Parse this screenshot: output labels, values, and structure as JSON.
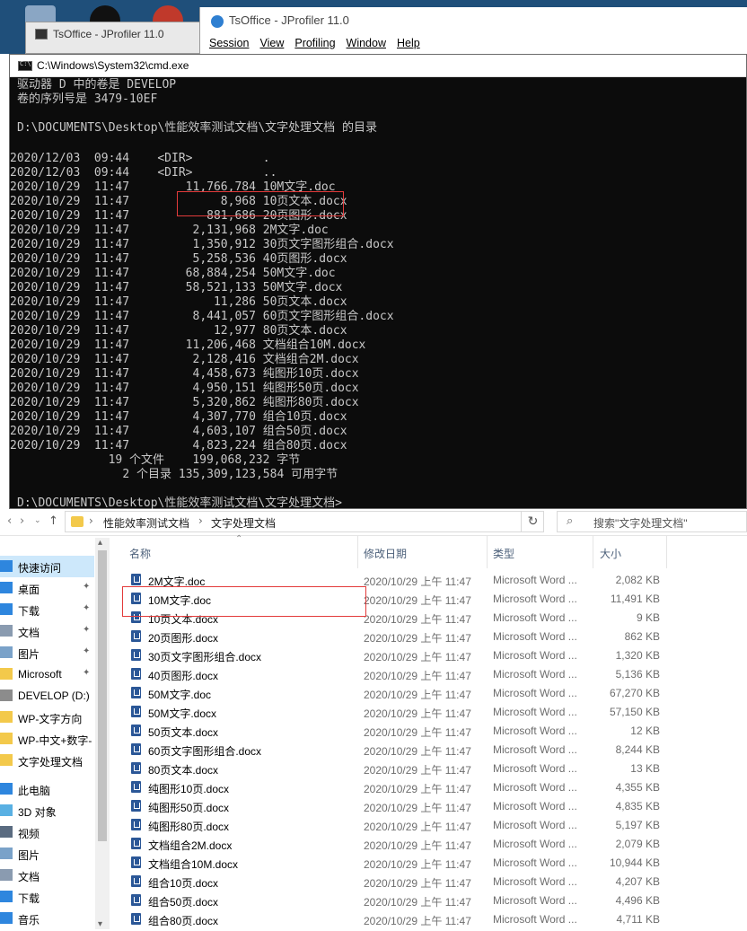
{
  "colors": {
    "cmd_bg": "#0c0c0c",
    "cmd_text": "#c8c8c8",
    "highlight_box": "#e33b3b",
    "nav_selected": "#cde8fb",
    "word_icon": "#2b5797",
    "folder": "#f3c94b"
  },
  "jprofiler_back": {
    "title": "TsOffice - JProfiler 11.0"
  },
  "jprofiler_front": {
    "title": "TsOffice - JProfiler 11.0",
    "menu": [
      "Session",
      "View",
      "Profiling",
      "Window",
      "Help"
    ]
  },
  "cmd": {
    "title": "C:\\Windows\\System32\\cmd.exe",
    "lines": [
      "驱动器 D 中的卷是 DEVELOP",
      "卷的序列号是 3479-10EF",
      "",
      "D:\\DOCUMENTS\\Desktop\\性能效率测试文档\\文字处理文档 的目录",
      "",
      "2020/12/03  09:44    <DIR>          .",
      "2020/12/03  09:44    <DIR>          ..",
      "2020/10/29  11:47        11,766,784 10M文字.doc",
      "2020/10/29  11:47             8,968 10页文本.docx",
      "2020/10/29  11:47           881,686 20页图形.docx",
      "2020/10/29  11:47         2,131,968 2M文字.doc",
      "2020/10/29  11:47         1,350,912 30页文字图形组合.docx",
      "2020/10/29  11:47         5,258,536 40页图形.docx",
      "2020/10/29  11:47        68,884,254 50M文字.doc",
      "2020/10/29  11:47        58,521,133 50M文字.docx",
      "2020/10/29  11:47            11,286 50页文本.docx",
      "2020/10/29  11:47         8,441,057 60页文字图形组合.docx",
      "2020/10/29  11:47            12,977 80页文本.docx",
      "2020/10/29  11:47        11,206,468 文档组合10M.docx",
      "2020/10/29  11:47         2,128,416 文档组合2M.docx",
      "2020/10/29  11:47         4,458,673 纯图形10页.docx",
      "2020/10/29  11:47         4,950,151 纯图形50页.docx",
      "2020/10/29  11:47         5,320,862 纯图形80页.docx",
      "2020/10/29  11:47         4,307,770 组合10页.docx",
      "2020/10/29  11:47         4,603,107 组合50页.docx",
      "2020/10/29  11:47         4,823,224 组合80页.docx",
      "              19 个文件    199,068,232 字节",
      "               2 个目录 135,309,123,584 可用字节",
      "",
      "D:\\DOCUMENTS\\Desktop\\性能效率测试文档\\文字处理文档>"
    ]
  },
  "explorer": {
    "address": {
      "crumbs": [
        "性能效率测试文档",
        "文字处理文档"
      ],
      "search_placeholder": "搜索\"文字处理文档\""
    },
    "nav": [
      {
        "label": "快速访问",
        "icon": "star-icon",
        "pinned": false,
        "selected": true
      },
      {
        "label": "桌面",
        "icon": "desktop-icon",
        "pinned": true,
        "selected": false
      },
      {
        "label": "下载",
        "icon": "download-icon",
        "pinned": true,
        "selected": false
      },
      {
        "label": "文档",
        "icon": "document-icon",
        "pinned": true,
        "selected": false
      },
      {
        "label": "图片",
        "icon": "picture-icon",
        "pinned": true,
        "selected": false
      },
      {
        "label": "Microsoft",
        "icon": "folder-icon",
        "pinned": true,
        "selected": false
      },
      {
        "label": "DEVELOP (D:)",
        "icon": "drive-icon",
        "pinned": false,
        "selected": false
      },
      {
        "label": "WP-文字方向",
        "icon": "folder-icon",
        "pinned": false,
        "selected": false
      },
      {
        "label": "WP-中文+数字-",
        "icon": "folder-icon",
        "pinned": false,
        "selected": false
      },
      {
        "label": "文字处理文档",
        "icon": "folder-icon",
        "pinned": false,
        "selected": false
      },
      {
        "label": "",
        "icon": "",
        "pinned": false,
        "selected": false
      },
      {
        "label": "此电脑",
        "icon": "computer-icon",
        "pinned": false,
        "selected": false
      },
      {
        "label": "3D 对象",
        "icon": "cube-icon",
        "pinned": false,
        "selected": false
      },
      {
        "label": "视频",
        "icon": "video-icon",
        "pinned": false,
        "selected": false
      },
      {
        "label": "图片",
        "icon": "picture-icon",
        "pinned": false,
        "selected": false
      },
      {
        "label": "文档",
        "icon": "document-icon",
        "pinned": false,
        "selected": false
      },
      {
        "label": "下载",
        "icon": "download-icon",
        "pinned": false,
        "selected": false
      },
      {
        "label": "音乐",
        "icon": "music-icon",
        "pinned": false,
        "selected": false
      }
    ],
    "columns": {
      "name": "名称",
      "date": "修改日期",
      "type": "类型",
      "size": "大小"
    },
    "files": [
      {
        "name": "2M文字.doc",
        "date": "2020/10/29 上午 11:47",
        "type": "Microsoft Word ...",
        "size": "2,082 KB"
      },
      {
        "name": "10M文字.doc",
        "date": "2020/10/29 上午 11:47",
        "type": "Microsoft Word ...",
        "size": "11,491 KB"
      },
      {
        "name": "10页文本.docx",
        "date": "2020/10/29 上午 11:47",
        "type": "Microsoft Word ...",
        "size": "9 KB"
      },
      {
        "name": "20页图形.docx",
        "date": "2020/10/29 上午 11:47",
        "type": "Microsoft Word ...",
        "size": "862 KB"
      },
      {
        "name": "30页文字图形组合.docx",
        "date": "2020/10/29 上午 11:47",
        "type": "Microsoft Word ...",
        "size": "1,320 KB"
      },
      {
        "name": "40页图形.docx",
        "date": "2020/10/29 上午 11:47",
        "type": "Microsoft Word ...",
        "size": "5,136 KB"
      },
      {
        "name": "50M文字.doc",
        "date": "2020/10/29 上午 11:47",
        "type": "Microsoft Word ...",
        "size": "67,270 KB"
      },
      {
        "name": "50M文字.docx",
        "date": "2020/10/29 上午 11:47",
        "type": "Microsoft Word ...",
        "size": "57,150 KB"
      },
      {
        "name": "50页文本.docx",
        "date": "2020/10/29 上午 11:47",
        "type": "Microsoft Word ...",
        "size": "12 KB"
      },
      {
        "name": "60页文字图形组合.docx",
        "date": "2020/10/29 上午 11:47",
        "type": "Microsoft Word ...",
        "size": "8,244 KB"
      },
      {
        "name": "80页文本.docx",
        "date": "2020/10/29 上午 11:47",
        "type": "Microsoft Word ...",
        "size": "13 KB"
      },
      {
        "name": "纯图形10页.docx",
        "date": "2020/10/29 上午 11:47",
        "type": "Microsoft Word ...",
        "size": "4,355 KB"
      },
      {
        "name": "纯图形50页.docx",
        "date": "2020/10/29 上午 11:47",
        "type": "Microsoft Word ...",
        "size": "4,835 KB"
      },
      {
        "name": "纯图形80页.docx",
        "date": "2020/10/29 上午 11:47",
        "type": "Microsoft Word ...",
        "size": "5,197 KB"
      },
      {
        "name": "文档组合2M.docx",
        "date": "2020/10/29 上午 11:47",
        "type": "Microsoft Word ...",
        "size": "2,079 KB"
      },
      {
        "name": "文档组合10M.docx",
        "date": "2020/10/29 上午 11:47",
        "type": "Microsoft Word ...",
        "size": "10,944 KB"
      },
      {
        "name": "组合10页.docx",
        "date": "2020/10/29 上午 11:47",
        "type": "Microsoft Word ...",
        "size": "4,207 KB"
      },
      {
        "name": "组合50页.docx",
        "date": "2020/10/29 上午 11:47",
        "type": "Microsoft Word ...",
        "size": "4,496 KB"
      },
      {
        "name": "组合80页.docx",
        "date": "2020/10/29 上午 11:47",
        "type": "Microsoft Word ...",
        "size": "4,711 KB"
      }
    ]
  }
}
